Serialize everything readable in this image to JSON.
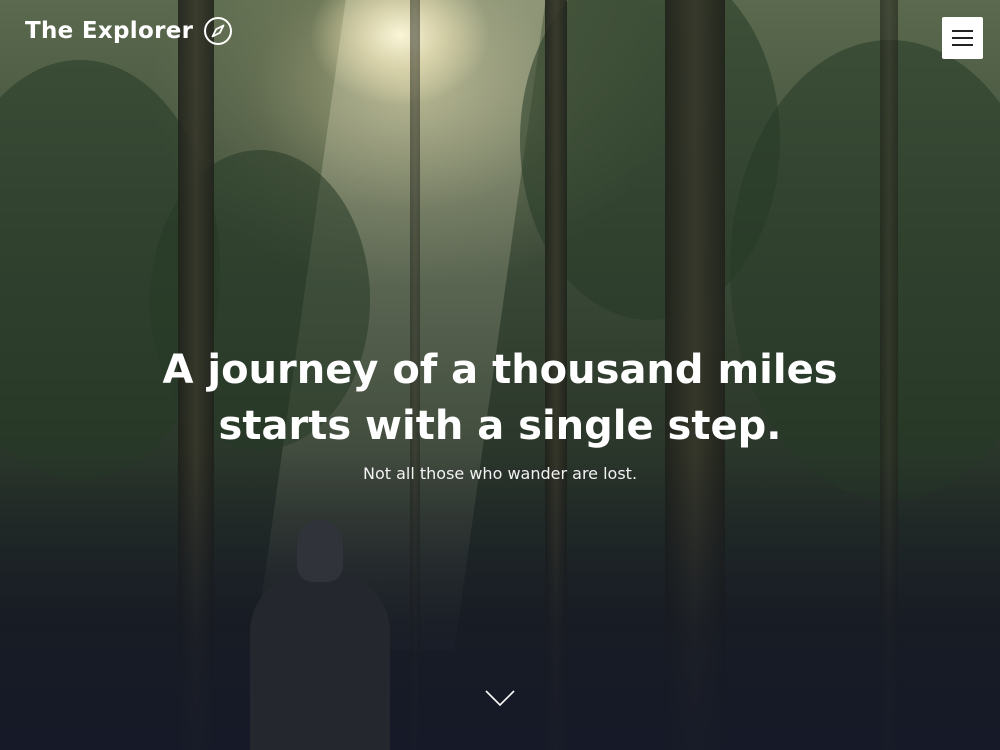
{
  "brand": {
    "name": "The Explorer",
    "icon": "compass-icon"
  },
  "nav": {
    "menu_icon": "hamburger-menu-icon"
  },
  "hero": {
    "headline_line1": "A journey of a thousand miles",
    "headline_line2": "starts with a single step.",
    "subtitle": "Not all those who wander are lost.",
    "scroll_icon": "chevron-down-icon"
  },
  "colors": {
    "text": "#ffffff",
    "menu_button_bg": "#ffffff",
    "menu_icon": "#222222",
    "overlay_bottom": "#1a1f28"
  }
}
